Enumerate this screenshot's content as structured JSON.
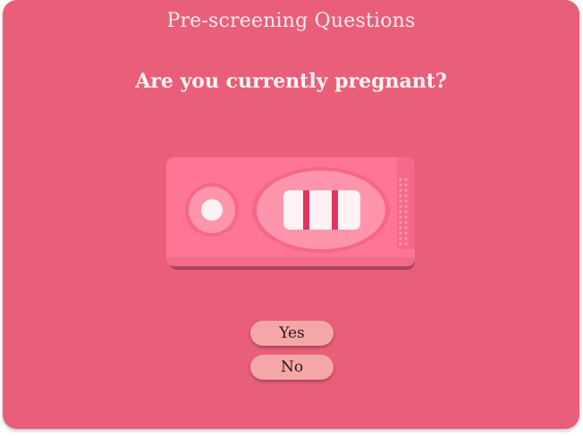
{
  "header": {
    "title": "Pre-screening Questions"
  },
  "question": {
    "text": "Are you currently pregnant?"
  },
  "illustration": {
    "icon": "pregnancy-test-icon",
    "lines_shown": 2
  },
  "answers": {
    "yes_label": "Yes",
    "no_label": "No"
  },
  "colors": {
    "background": "#e95e79",
    "test_body": "#ff7594",
    "button": "#f4a7a6",
    "result_line": "#e3335f"
  }
}
